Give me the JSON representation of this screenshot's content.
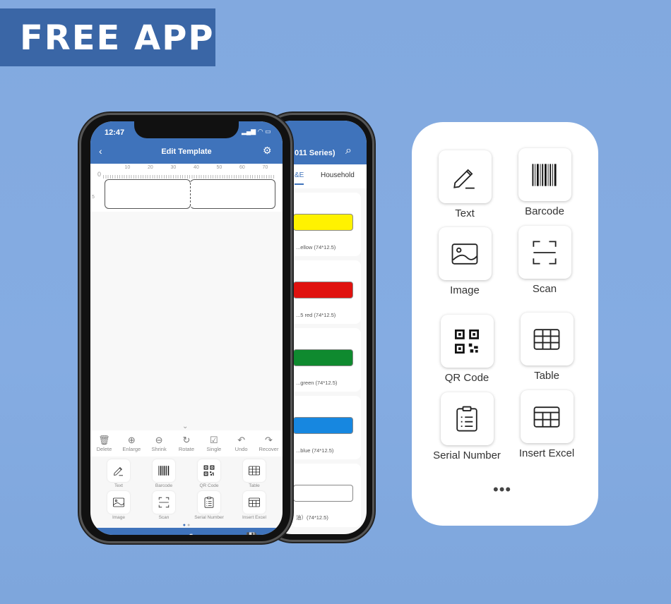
{
  "banner": {
    "title": "FREE APP"
  },
  "front_phone": {
    "time": "12:47",
    "title": "Edit Template",
    "ruler_ticks": [
      "0",
      "10",
      "20",
      "30",
      "40",
      "50",
      "60",
      "70"
    ],
    "ruler_side": "5",
    "toolbar": [
      "Delete",
      "Enlarge",
      "Shrink",
      "Rotate",
      "Single",
      "Undo",
      "Recover"
    ],
    "elements": [
      "Text",
      "Barcode",
      "QR Code",
      "Table",
      "Image",
      "Scan",
      "Serial Number",
      "Insert Excel"
    ],
    "bottom": [
      "Preview",
      "Print",
      "Save"
    ]
  },
  "back_phone": {
    "title": "011 Series)",
    "tabs": [
      "&E",
      "Household"
    ],
    "labels": [
      {
        "name": "...ellow (74*12.5)",
        "color": "#fff200"
      },
      {
        "name": "...5 red (74*12.5)",
        "color": "#e0120f"
      },
      {
        "name": "...green (74*12.5)",
        "color": "#0f8a2f"
      },
      {
        "name": "...blue (74*12.5)",
        "color": "#1787e0"
      },
      {
        "name": "油）(74*12.5)",
        "color": "#ffffff"
      }
    ]
  },
  "card": {
    "items": [
      "Text",
      "Barcode",
      "Image",
      "Scan",
      "QR Code",
      "Table",
      "Serial Number",
      "Insert Excel"
    ],
    "more": "•••"
  }
}
